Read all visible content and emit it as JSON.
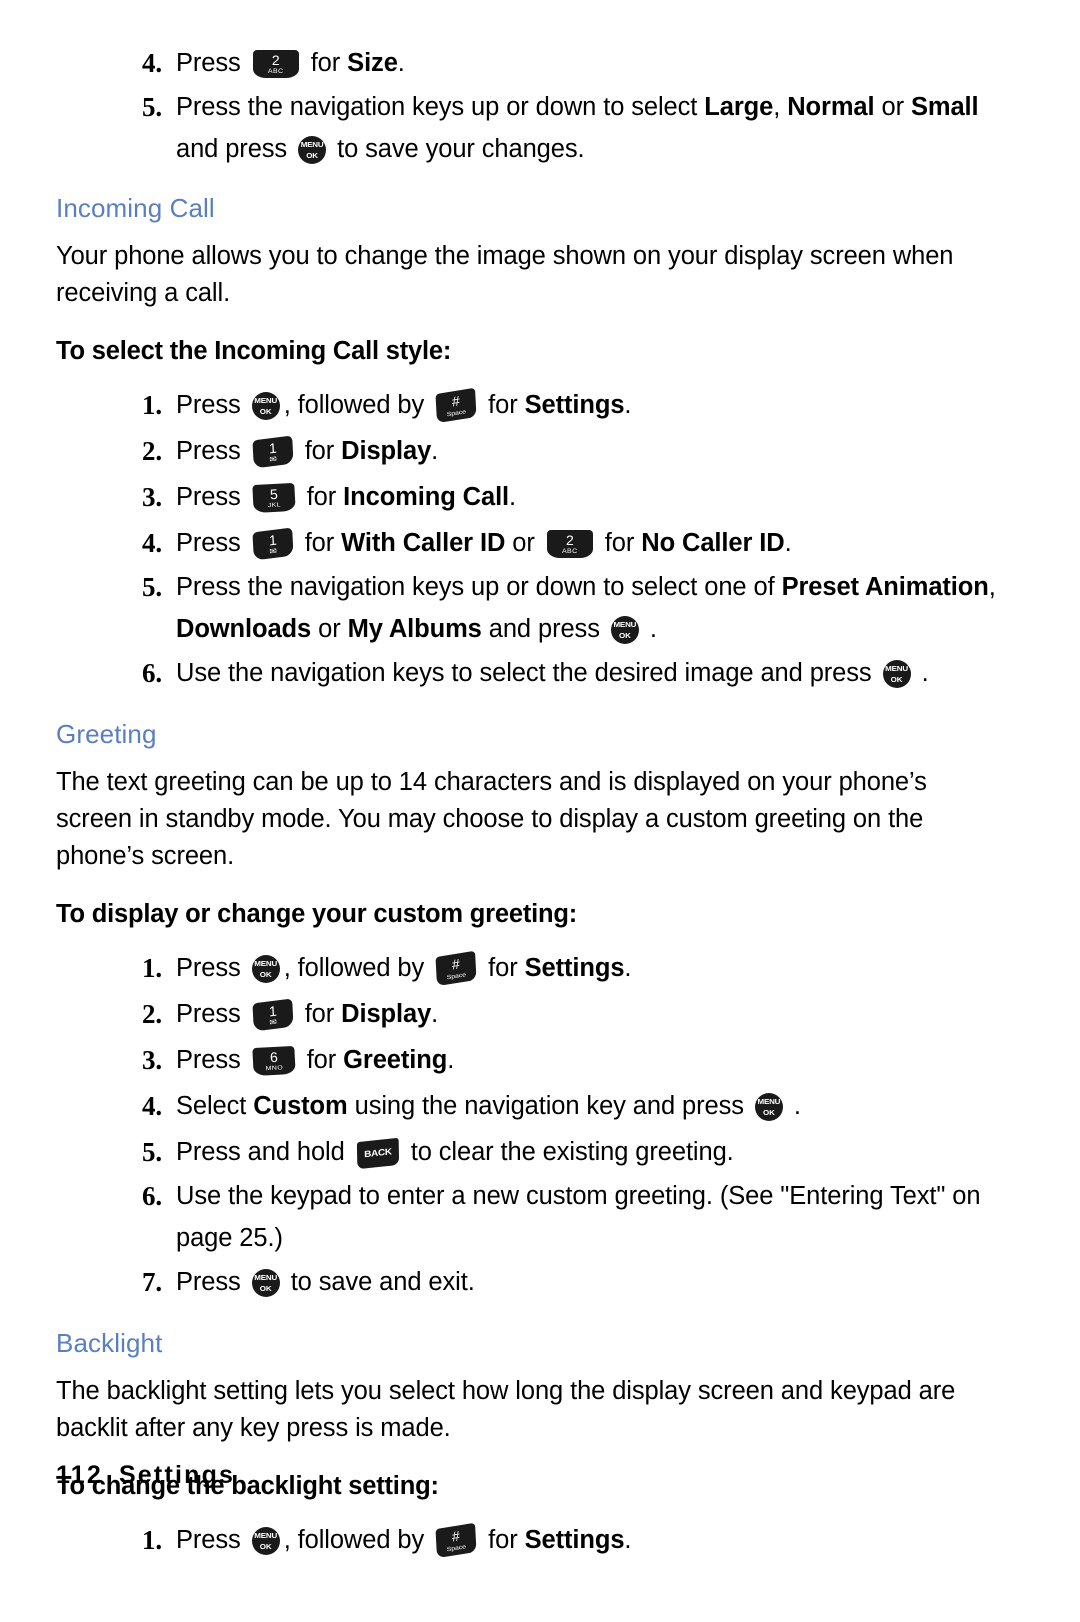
{
  "page": {
    "number": "112",
    "section": "Settings",
    "heading_color": "#5a7fc0"
  },
  "keys": {
    "menu_ok": {
      "top": "MENU",
      "bottom": "OK",
      "name": "menu-ok-key"
    },
    "hash_space": {
      "top": "#",
      "bottom": "Space",
      "name": "hash-space-key"
    },
    "back": {
      "label": "BACK",
      "name": "back-key"
    },
    "k1": {
      "digit": "1",
      "letters": "✉",
      "name": "keypad-1-key"
    },
    "k2": {
      "digit": "2",
      "letters": "ABC",
      "name": "keypad-2-key"
    },
    "k5": {
      "digit": "5",
      "letters": "JKL",
      "name": "keypad-5-key"
    },
    "k6": {
      "digit": "6",
      "letters": "MNO",
      "name": "keypad-6-key"
    }
  },
  "top_steps": {
    "step4": {
      "num": "4.",
      "pre": "Press",
      "mid": "for",
      "bold": "Size",
      "post": "."
    },
    "step5": {
      "num": "5.",
      "pre": "Press the navigation keys up or down to select",
      "b1": "Large",
      "sep1": ",",
      "b2": "Normal",
      "sep2": "or",
      "b3": "Small",
      "line2_pre": "and press",
      "line2_post": "to save your changes."
    }
  },
  "incoming_call": {
    "heading": "Incoming Call",
    "intro": "Your phone allows you to change the image shown on your display screen when receiving a call.",
    "task_heading": "To select the Incoming Call style:",
    "steps": [
      {
        "num": "1.",
        "pre": "Press",
        "mid": ", followed by",
        "mid2": "for",
        "bold": "Settings",
        "post": "."
      },
      {
        "num": "2.",
        "pre": "Press",
        "mid": "for",
        "bold": "Display",
        "post": "."
      },
      {
        "num": "3.",
        "pre": "Press",
        "mid": "for",
        "bold": "Incoming Call",
        "post": "."
      },
      {
        "num": "4.",
        "pre": "Press",
        "mid": "for",
        "bold": "With Caller ID",
        "mid2": "or",
        "mid3": "for",
        "bold2": "No Caller ID",
        "post": "."
      },
      {
        "num": "5.",
        "pre": "Press the navigation keys up or down to select one of",
        "b1": "Preset Animation",
        "sep1": ",",
        "b2": "Downloads",
        "sep2": "or",
        "b3": "My Albums",
        "tail": "and press",
        "post": "."
      },
      {
        "num": "6.",
        "pre": "Use the navigation keys to select the desired image and press",
        "post": "."
      }
    ]
  },
  "greeting": {
    "heading": "Greeting",
    "intro": "The text greeting can be up to 14 characters and is displayed on your phone’s screen in standby mode. You may choose to display a custom greeting on the phone’s screen.",
    "task_heading": "To display or change your custom greeting:",
    "steps": [
      {
        "num": "1.",
        "pre": "Press",
        "mid": ", followed by",
        "mid2": "for",
        "bold": "Settings",
        "post": "."
      },
      {
        "num": "2.",
        "pre": "Press",
        "mid": "for",
        "bold": "Display",
        "post": "."
      },
      {
        "num": "3.",
        "pre": "Press",
        "mid": "for",
        "bold": "Greeting",
        "post": "."
      },
      {
        "num": "4.",
        "pre": "Select",
        "bold": "Custom",
        "mid": "using the navigation key and press",
        "post": "."
      },
      {
        "num": "5.",
        "pre": "Press and hold",
        "mid": "to clear the existing greeting."
      },
      {
        "num": "6.",
        "pre": "Use the keypad to enter a new custom greeting. (See \"Entering Text\" on page 25.)"
      },
      {
        "num": "7.",
        "pre": "Press",
        "post": "to save and exit."
      }
    ]
  },
  "backlight": {
    "heading": "Backlight",
    "intro": "The backlight setting lets you select how long the display screen and keypad are backlit after any key press is made.",
    "task_heading": "To change the backlight setting:",
    "steps": [
      {
        "num": "1.",
        "pre": "Press",
        "mid": ", followed by",
        "mid2": "for",
        "bold": "Settings",
        "post": "."
      }
    ]
  }
}
